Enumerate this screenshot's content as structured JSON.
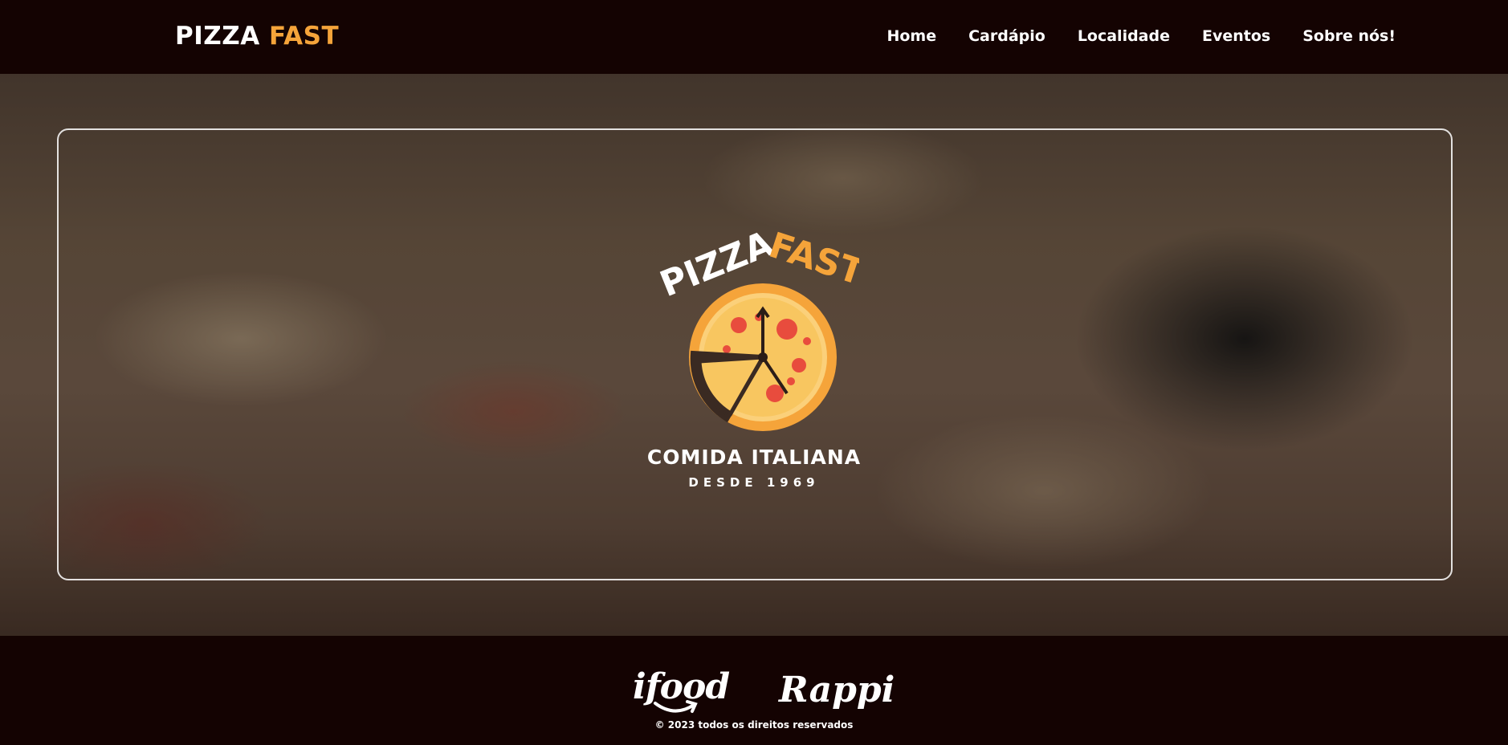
{
  "header": {
    "brand_main": "PIZZA",
    "brand_accent": "FAST",
    "nav": [
      "Home",
      "Cardápio",
      "Localidade",
      "Eventos",
      "Sobre nós!"
    ]
  },
  "hero": {
    "logo_word_1": "PIZZA",
    "logo_word_2": "FAST",
    "tagline": "COMIDA ITALIANA",
    "subtagline": "DESDE 1969"
  },
  "footer": {
    "partner_1": "ifood",
    "partner_2": "Rappi",
    "copyright": "© 2023 todos os direitos reservados"
  },
  "colors": {
    "background": "#140302",
    "accent": "#f5a43a",
    "pizza_crust": "#f5a43a",
    "pizza_cheese": "#f8c660",
    "pepperoni": "#e84c3d"
  }
}
